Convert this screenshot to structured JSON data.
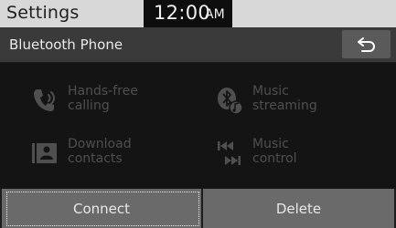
{
  "status_bar": {
    "title": "Settings",
    "time": "12:00",
    "ampm": "AM"
  },
  "header": {
    "title": "Bluetooth Phone",
    "back_icon": "back-arrow-icon"
  },
  "features": [
    {
      "icon": "handsfree-phone-icon",
      "line1": "Hands-free",
      "line2": "calling"
    },
    {
      "icon": "bluetooth-music-icon",
      "line1": "Music",
      "line2": "streaming"
    },
    {
      "icon": "contacts-download-icon",
      "line1": "Download",
      "line2": "contacts"
    },
    {
      "icon": "music-control-icon",
      "line1": "Music",
      "line2": "control"
    }
  ],
  "buttons": {
    "connect": "Connect",
    "delete": "Delete"
  },
  "colors": {
    "status_bar": "#d8d8d8",
    "header": "#3a3a3a",
    "button": "#6a6a6a",
    "disabled_text": "#4f4f4f"
  }
}
